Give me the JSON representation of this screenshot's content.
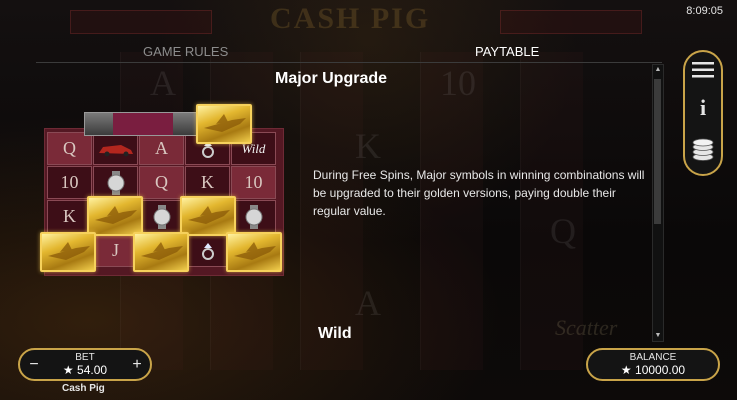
{
  "status": {
    "clock": "8:09:05"
  },
  "background": {
    "logo": "CASH PIG",
    "scatter": "Scatter"
  },
  "tabs": {
    "game_rules": "GAME RULES",
    "paytable": "PAYTABLE",
    "active": "paytable"
  },
  "paytable": {
    "section_title": "Major Upgrade",
    "description": "During Free Spins, Major symbols in winning combinations will be upgraded to their golden versions, paying double their regular value.",
    "next_section_title": "Wild",
    "example_grid": {
      "rows": [
        [
          "Q",
          "car",
          "A",
          "diamond-ring",
          "Wild"
        ],
        [
          "10",
          "watch",
          "Q",
          "K",
          "10"
        ],
        [
          "K",
          "gold-jet",
          "watch",
          "gold-jet",
          "watch"
        ],
        [
          "gold-jet",
          "J",
          "gold-jet",
          "diamond-ring",
          "gold-jet"
        ]
      ]
    }
  },
  "side_menu": {
    "items": [
      "menu-icon",
      "info-icon",
      "coins-icon"
    ]
  },
  "bet": {
    "label": "BET",
    "value": "54.00",
    "currency_icon": "star-icon",
    "minus": "−",
    "plus": "+"
  },
  "game_name": "Cash Pig",
  "balance": {
    "label": "BALANCE",
    "value": "10000.00",
    "currency_icon": "star-icon"
  },
  "colors": {
    "accent_gold": "#c9a449",
    "grid_bg": "#541823",
    "gold_symbol": "#e3b72f"
  }
}
